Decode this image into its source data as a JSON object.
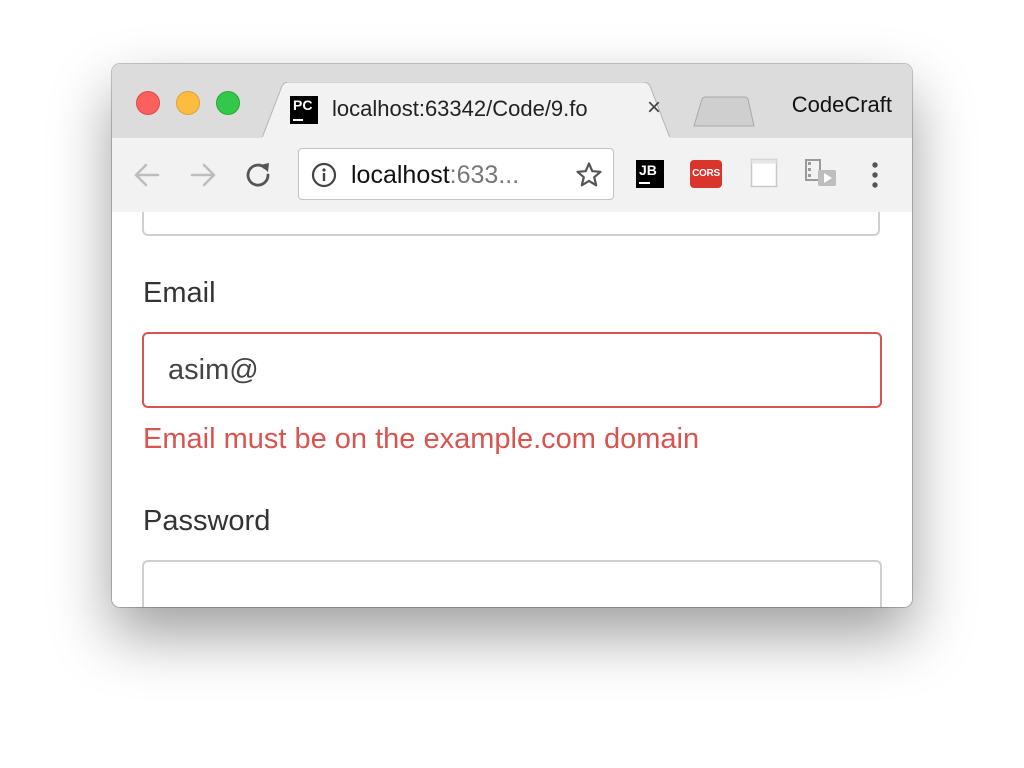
{
  "window": {
    "controls": [
      "close",
      "minimize",
      "maximize"
    ]
  },
  "tab": {
    "favicon_text": "PC",
    "title": "localhost:63342/Code/9.fo",
    "close_glyph": "×"
  },
  "profile": {
    "name": "CodeCraft"
  },
  "toolbar": {
    "url_host": "localhost",
    "url_rest": ":633...",
    "extensions": [
      {
        "name": "jetbrains-ide-support",
        "text": "JB"
      },
      {
        "name": "cors",
        "text": "CORS"
      },
      {
        "name": "blank-extension",
        "text": ""
      },
      {
        "name": "media-extension",
        "text": ""
      }
    ]
  },
  "form": {
    "email_label": "Email",
    "email_value": "asim@",
    "email_error": "Email must be on the example.com domain",
    "password_label": "Password",
    "password_value": ""
  },
  "colors": {
    "error": "#d9534f",
    "close": "#fc605c",
    "minimize": "#fdbc40",
    "maximize": "#34c84a",
    "cors": "#d9352c"
  }
}
